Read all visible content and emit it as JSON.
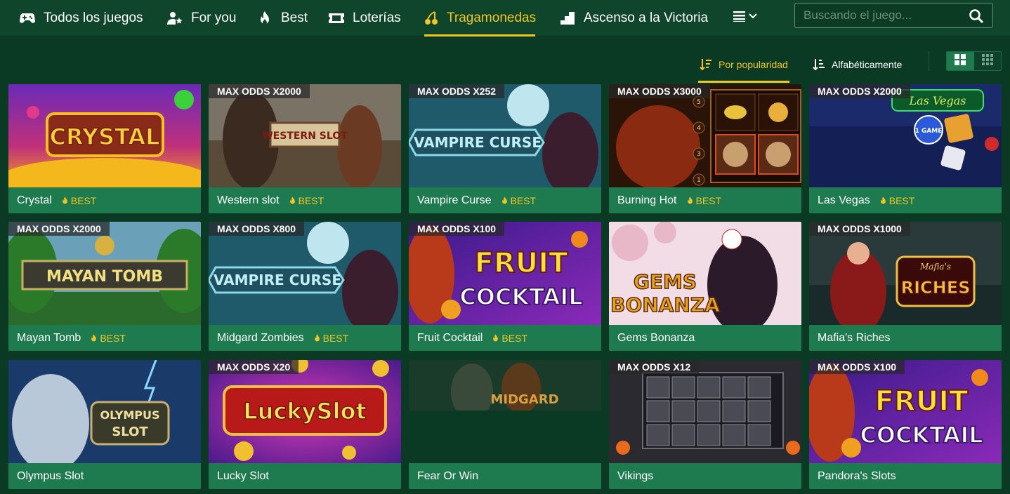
{
  "nav": {
    "items": [
      {
        "label": "Todos los juegos",
        "icon": "gamepad-icon"
      },
      {
        "label": "For you",
        "icon": "user-star-icon"
      },
      {
        "label": "Best",
        "icon": "flame-icon"
      },
      {
        "label": "Loterías",
        "icon": "ticket-icon"
      },
      {
        "label": "Tragamonedas",
        "icon": "cherries-icon",
        "active": true
      },
      {
        "label": "Ascenso a la Victoria",
        "icon": "stairs-icon"
      }
    ],
    "more_icon": "menu-chevron-icon"
  },
  "search": {
    "placeholder": "Buscando el juego...",
    "value": ""
  },
  "sort": {
    "popularity_label": "Por popularidad",
    "alpha_label": "Alfabéticamente",
    "active": "popularity"
  },
  "view": {
    "selected": "large-grid"
  },
  "accent_color": "#f2c524",
  "card_color": "#1e7a4f",
  "background_color": "#0b3a24",
  "games": [
    {
      "title": "Crystal",
      "odds": "",
      "best": "BEST"
    },
    {
      "title": "Western slot",
      "odds": "MAX ODDS X2000",
      "best": "BEST"
    },
    {
      "title": "Vampire Curse",
      "odds": "MAX ODDS X252",
      "best": "BEST"
    },
    {
      "title": "Burning Hot",
      "odds": "MAX ODDS X3000",
      "best": "BEST"
    },
    {
      "title": "Las Vegas",
      "odds": "MAX ODDS X2000",
      "best": "BEST"
    },
    {
      "title": "Mayan Tomb",
      "odds": "MAX ODDS X2000",
      "best": "BEST"
    },
    {
      "title": "Midgard Zombies",
      "odds": "MAX ODDS X800",
      "best": "BEST"
    },
    {
      "title": "Fruit Cocktail",
      "odds": "MAX ODDS X100",
      "best": "BEST"
    },
    {
      "title": "Gems Bonanza",
      "odds": "",
      "best": ""
    },
    {
      "title": "Mafia's Riches",
      "odds": "MAX ODDS X1000",
      "best": ""
    },
    {
      "title": "Olympus Slot",
      "odds": "",
      "best": ""
    },
    {
      "title": "Lucky Slot",
      "odds": "MAX ODDS X20",
      "best": ""
    },
    {
      "title": "Fear Or Win",
      "odds": "",
      "best": ""
    },
    {
      "title": "Vikings",
      "odds": "MAX ODDS X12",
      "best": ""
    },
    {
      "title": "Pandora's Slots",
      "odds": "MAX ODDS X100",
      "best": ""
    }
  ],
  "artwork": {
    "crystal": "CRYSTAL",
    "western": "WESTERN SLOT",
    "vampire": "VAMPIRE CURSE",
    "mayan": "MAYAN TOMB",
    "fruit_top": "FRUIT",
    "fruit_bottom": "COCKTAIL",
    "gems_top": "GEMS",
    "gems_bottom": "BONANZA",
    "mafia_small": "Mafia's",
    "mafia_big": "RICHES",
    "olympus_top": "OLYMPUS",
    "olympus_bottom": "SLOT",
    "lucky": "LuckySlot",
    "midgard": "MIDGARD",
    "vegas": "Las Vegas",
    "vegas_chip": "1 GAME",
    "reel_numbers": [
      "5",
      "4",
      "3",
      "2",
      "1"
    ]
  }
}
